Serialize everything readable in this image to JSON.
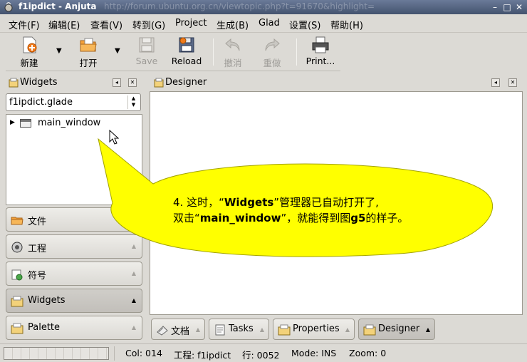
{
  "window": {
    "title": "f1ipdict - Anjuta",
    "background_url_ghost": "http://forum.ubuntu.org.cn/viewtopic.php?t=91670&highlight="
  },
  "menubar": {
    "items": [
      "文件(F)",
      "编辑(E)",
      "查看(V)",
      "转到(G)",
      "Project",
      "生成(B)",
      "Glad",
      "设置(S)",
      "帮助(H)"
    ]
  },
  "toolbar": {
    "new_label": "新建",
    "open_label": "打开",
    "save_label": "Save",
    "reload_label": "Reload",
    "undo_label": "撤消",
    "redo_label": "重做",
    "print_label": "Print..."
  },
  "widgets_pane": {
    "title": "Widgets",
    "combo_value": "f1ipdict.glade",
    "tree_items": [
      "main_window"
    ]
  },
  "dock_buttons": [
    "文件",
    "工程",
    "符号",
    "Widgets",
    "Palette"
  ],
  "designer_pane": {
    "title": "Designer"
  },
  "bottom_tabs": [
    "文档",
    "Tasks",
    "Properties",
    "Designer"
  ],
  "statusbar": {
    "col": "Col: 014",
    "project": "工程: f1ipdict",
    "line": "行: 0052",
    "mode": "Mode: INS",
    "zoom": "Zoom: 0"
  },
  "annotation": {
    "line1_prefix": "4. 这时，“",
    "line1_bold": "Widgets",
    "line1_suffix": "”管理器已自动打开了,",
    "line2_prefix": "双击“",
    "line2_bold": "main_window",
    "line2_mid": "”，就能得到图",
    "line2_bold2": "g5",
    "line2_suffix": "的样子。"
  },
  "colors": {
    "callout_fill": "#ffff00",
    "titlebar": "#55647f",
    "window_bg": "#dcdad5"
  }
}
